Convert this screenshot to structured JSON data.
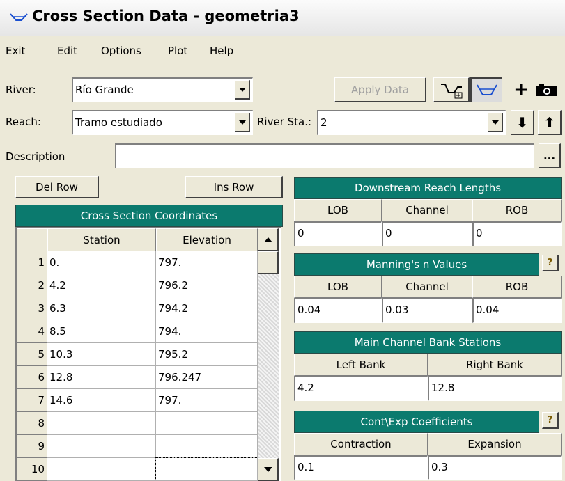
{
  "window": {
    "title": "Cross Section Data - geometria3"
  },
  "menu": [
    "Exit",
    "Edit",
    "Options",
    "Plot",
    "Help"
  ],
  "river": {
    "label": "River:",
    "value": "Río Grande"
  },
  "reach": {
    "label": "Reach:",
    "value": "Tramo estudiado"
  },
  "river_sta": {
    "label": "River Sta.:",
    "value": "2"
  },
  "apply_label": "Apply Data",
  "description": {
    "label": "Description",
    "value": "",
    "browse_label": "..."
  },
  "del_row_label": "Del Row",
  "ins_row_label": "Ins Row",
  "coords": {
    "title": "Cross Section Coordinates",
    "headers": [
      "Station",
      "Elevation"
    ],
    "rows": [
      {
        "n": "1",
        "station": "0.",
        "elevation": "797."
      },
      {
        "n": "2",
        "station": "4.2",
        "elevation": "796.2"
      },
      {
        "n": "3",
        "station": "6.3",
        "elevation": "794.2"
      },
      {
        "n": "4",
        "station": "8.5",
        "elevation": "794."
      },
      {
        "n": "5",
        "station": "10.3",
        "elevation": "795.2"
      },
      {
        "n": "6",
        "station": "12.8",
        "elevation": "796.247"
      },
      {
        "n": "7",
        "station": "14.6",
        "elevation": "797."
      },
      {
        "n": "8",
        "station": "",
        "elevation": ""
      },
      {
        "n": "9",
        "station": "",
        "elevation": ""
      },
      {
        "n": "10",
        "station": "",
        "elevation": ""
      }
    ]
  },
  "reach_lengths": {
    "title": "Downstream Reach Lengths",
    "headers": [
      "LOB",
      "Channel",
      "ROB"
    ],
    "values": [
      "0",
      "0",
      "0"
    ]
  },
  "mannings": {
    "title": "Manning's n Values",
    "help": "?",
    "headers": [
      "LOB",
      "Channel",
      "ROB"
    ],
    "values": [
      "0.04",
      "0.03",
      "0.04"
    ]
  },
  "bank_stations": {
    "title": "Main Channel Bank Stations",
    "headers": [
      "Left Bank",
      "Right Bank"
    ],
    "values": [
      "4.2",
      "12.8"
    ]
  },
  "coefficients": {
    "title": "Cont\\Exp  Coefficients",
    "help": "?",
    "headers": [
      "Contraction",
      "Expansion"
    ],
    "values": [
      "0.1",
      "0.3"
    ]
  },
  "colors": {
    "teal": "#0b7a6e",
    "face": "#ece9d8"
  }
}
